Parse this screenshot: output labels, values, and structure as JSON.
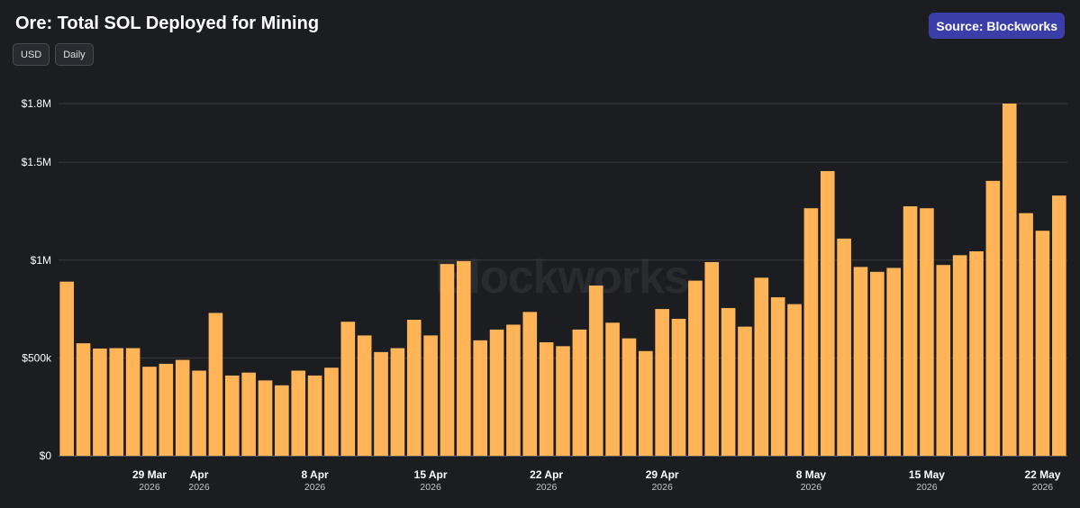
{
  "header": {
    "title": "Ore: Total SOL Deployed for Mining",
    "source_label": "Source: Blockworks"
  },
  "toolbar": {
    "currency_label": "USD",
    "interval_label": "Daily"
  },
  "watermark": "Blockworks",
  "colors": {
    "background": "#1c1d21",
    "bar": "#ffb457",
    "grid": "#3a3b40",
    "accent": "#3b3ea8"
  },
  "chart_data": {
    "type": "bar",
    "title": "Ore: Total SOL Deployed for Mining",
    "xlabel": "",
    "ylabel": "",
    "ylim": [
      0,
      1800000
    ],
    "grid": true,
    "y_ticks": [
      {
        "value": 0,
        "label": "$0"
      },
      {
        "value": 500000,
        "label": "$500k"
      },
      {
        "value": 1000000,
        "label": "$1M"
      },
      {
        "value": 1500000,
        "label": "$1.5M"
      },
      {
        "value": 1800000,
        "label": "$1.8M"
      }
    ],
    "x_ticks": [
      {
        "index": 5,
        "label": "29 Mar",
        "sub": "2026"
      },
      {
        "index": 8,
        "label": "Apr",
        "sub": "2026"
      },
      {
        "index": 15,
        "label": "8 Apr",
        "sub": "2026"
      },
      {
        "index": 22,
        "label": "15 Apr",
        "sub": "2026"
      },
      {
        "index": 29,
        "label": "22 Apr",
        "sub": "2026"
      },
      {
        "index": 36,
        "label": "29 Apr",
        "sub": "2026"
      },
      {
        "index": 45,
        "label": "8 May",
        "sub": "2026"
      },
      {
        "index": 52,
        "label": "15 May",
        "sub": "2026"
      },
      {
        "index": 59,
        "label": "22 May",
        "sub": "2026"
      }
    ],
    "values": [
      890000,
      575000,
      548000,
      550000,
      550000,
      455000,
      470000,
      490000,
      435000,
      730000,
      410000,
      425000,
      385000,
      360000,
      435000,
      410000,
      450000,
      685000,
      615000,
      530000,
      550000,
      695000,
      615000,
      980000,
      995000,
      590000,
      645000,
      670000,
      735000,
      580000,
      560000,
      645000,
      870000,
      680000,
      600000,
      535000,
      750000,
      700000,
      895000,
      990000,
      755000,
      660000,
      910000,
      810000,
      775000,
      1265000,
      1455000,
      1110000,
      965000,
      940000,
      960000,
      1275000,
      1265000,
      975000,
      1025000,
      1045000,
      1405000,
      1800000,
      1240000,
      1150000,
      1330000
    ]
  }
}
